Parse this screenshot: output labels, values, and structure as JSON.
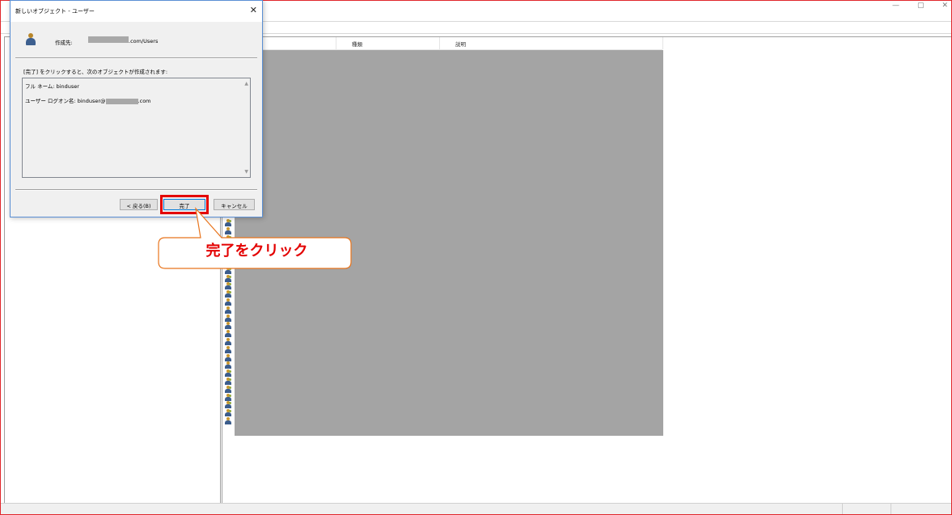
{
  "main_window": {
    "min_glyph": "—",
    "max_glyph": "▢",
    "close_glyph": "✕"
  },
  "list_header": {
    "col_type": "種類",
    "col_description": "説明"
  },
  "row_icons": [
    "group",
    "user",
    "group",
    "group",
    "group",
    "group",
    "group",
    "group",
    "group",
    "group",
    "user",
    "user",
    "user",
    "user",
    "user",
    "user",
    "user",
    "user",
    "user",
    "group",
    "group",
    "group",
    "group",
    "group",
    "group",
    "user"
  ],
  "dialog": {
    "title": "新しいオブジェクト - ユーザー",
    "close_glyph": "✕",
    "create_in_label": "作成先:",
    "create_in_path": ".com/Users",
    "instruction": "[完了] をクリックすると、次のオブジェクトが作成されます:",
    "summary": {
      "full_name_line": "フル ネーム: binduser",
      "logon_prefix": "ユーザー ログオン名: binduser@",
      "logon_suffix": ".com"
    },
    "buttons": {
      "back": "< 戻る(B)",
      "finish": "完了",
      "cancel": "キャンセル"
    }
  },
  "callout": {
    "text": "完了をクリック",
    "color": "#e30000"
  },
  "colors": {
    "window_border": "#e0262b",
    "redaction": "#a4a4a4",
    "highlight": "#e30000"
  }
}
